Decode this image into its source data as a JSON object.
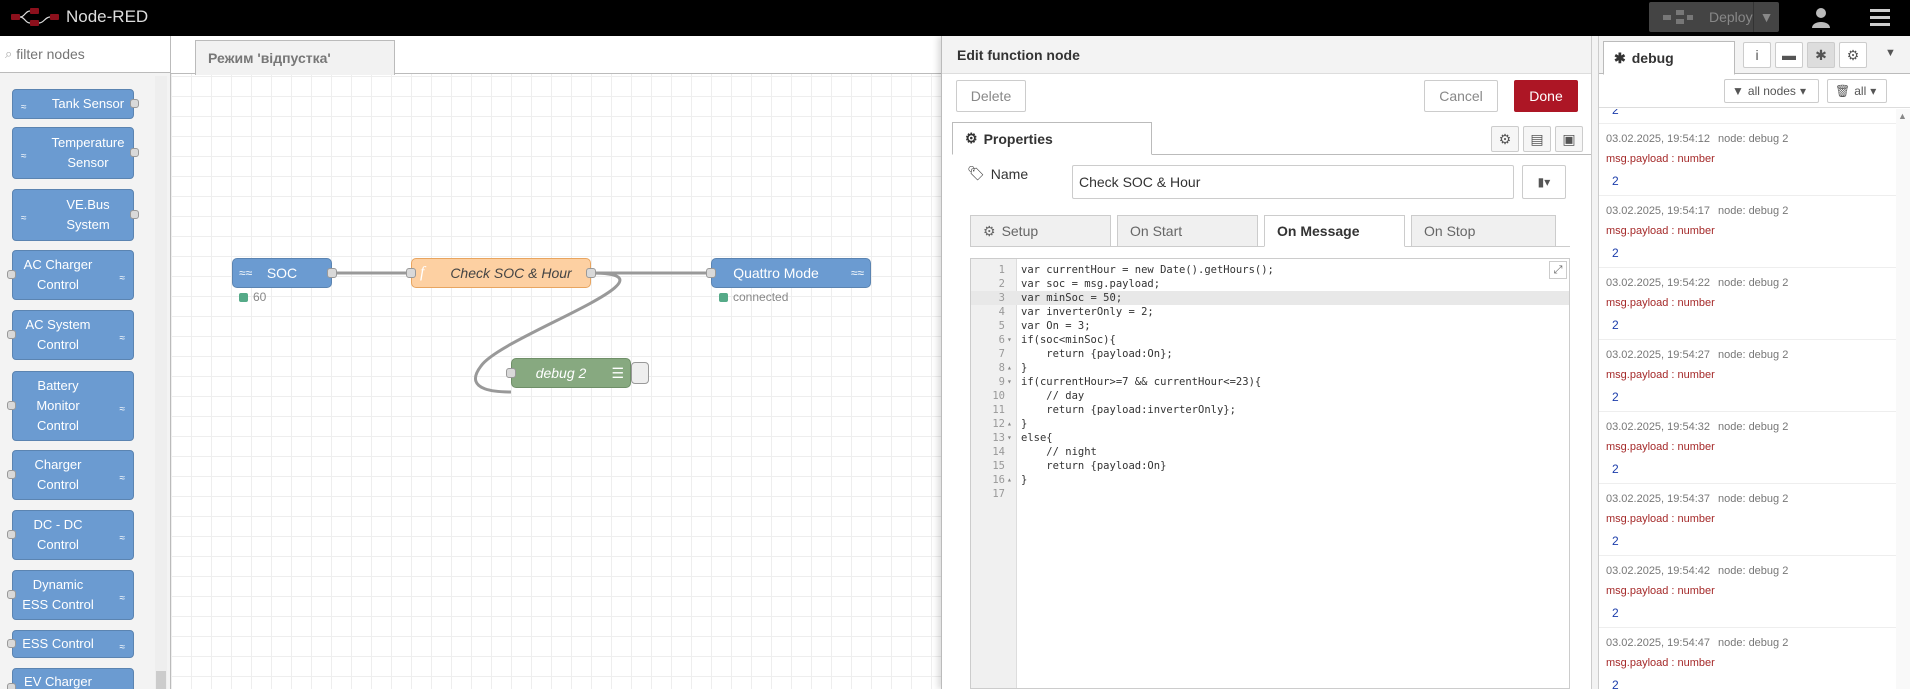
{
  "app": {
    "title": "Node-RED"
  },
  "header": {
    "deploy_label": "Deploy"
  },
  "palette": {
    "filter_placeholder": "filter nodes",
    "nodes": [
      {
        "label": "Tank Sensor",
        "side": "in"
      },
      {
        "label": "Temperature Sensor",
        "side": "in"
      },
      {
        "label": "VE.Bus System",
        "side": "in"
      },
      {
        "label": "AC Charger Control",
        "side": "out"
      },
      {
        "label": "AC System Control",
        "side": "out"
      },
      {
        "label": "Battery Monitor Control",
        "side": "out"
      },
      {
        "label": "Charger Control",
        "side": "out"
      },
      {
        "label": "DC - DC Control",
        "side": "out"
      },
      {
        "label": "Dynamic ESS Control",
        "side": "out"
      },
      {
        "label": "ESS Control",
        "side": "out"
      },
      {
        "label": "EV Charger",
        "side": "out"
      }
    ]
  },
  "workspace": {
    "tab_label": "Режим 'відпустка'",
    "nodes": {
      "soc": {
        "label": "SOC",
        "status": "60"
      },
      "function": {
        "label": "Check SOC & Hour"
      },
      "quattro": {
        "label": "Quattro Mode",
        "status": "connected"
      },
      "debug": {
        "label": "debug 2"
      }
    }
  },
  "tray": {
    "title": "Edit function node",
    "delete_label": "Delete",
    "cancel_label": "Cancel",
    "done_label": "Done",
    "properties_label": "Properties",
    "name_label": "Name",
    "name_value": "Check SOC & Hour",
    "tabs": [
      {
        "label": "Setup",
        "icon": "gear"
      },
      {
        "label": "On Start"
      },
      {
        "label": "On Message",
        "active": true
      },
      {
        "label": "On Stop"
      }
    ],
    "code_lines": [
      "var currentHour = new Date().getHours();",
      "var soc = msg.payload;",
      "var minSoc = 50;",
      "var inverterOnly = 2;",
      "var On = 3;",
      "if(soc<minSoc){",
      "    return {payload:On};",
      "}",
      "if(currentHour>=7 && currentHour<=23){",
      "    // day",
      "    return {payload:inverterOnly};",
      "}",
      "else{",
      "    // night",
      "    return {payload:On}",
      "}",
      ""
    ]
  },
  "sidebar": {
    "tab_label": "debug",
    "filter_nodes_label": "all nodes",
    "clear_label": "all",
    "messages": [
      {
        "time": "03.02.2025, 19:54:12",
        "node": "node: debug 2",
        "topic": "msg.payload : number",
        "value": "2"
      },
      {
        "time": "03.02.2025, 19:54:17",
        "node": "node: debug 2",
        "topic": "msg.payload : number",
        "value": "2"
      },
      {
        "time": "03.02.2025, 19:54:22",
        "node": "node: debug 2",
        "topic": "msg.payload : number",
        "value": "2"
      },
      {
        "time": "03.02.2025, 19:54:27",
        "node": "node: debug 2",
        "topic": "msg.payload : number",
        "value": "2"
      },
      {
        "time": "03.02.2025, 19:54:32",
        "node": "node: debug 2",
        "topic": "msg.payload : number",
        "value": "2"
      },
      {
        "time": "03.02.2025, 19:54:37",
        "node": "node: debug 2",
        "topic": "msg.payload : number",
        "value": "2"
      },
      {
        "time": "03.02.2025, 19:54:42",
        "node": "node: debug 2",
        "topic": "msg.payload : number",
        "value": "2"
      },
      {
        "time": "03.02.2025, 19:54:47",
        "node": "node: debug 2",
        "topic": "msg.payload : number",
        "value": "2"
      }
    ],
    "partial_top_value": "2"
  }
}
